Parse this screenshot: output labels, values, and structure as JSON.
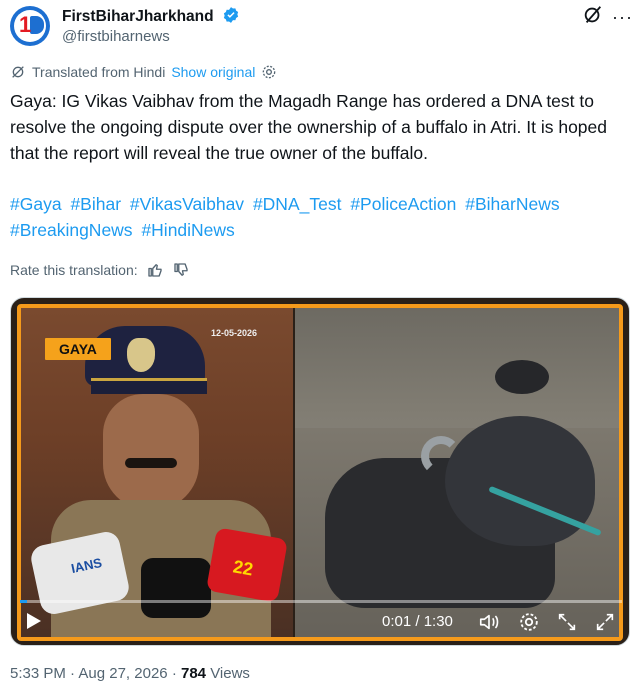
{
  "account": {
    "display_name": "FirstBiharJharkhand",
    "handle": "@firstbiharnews"
  },
  "translation": {
    "label": "Translated from Hindi",
    "show_original": "Show original",
    "rate_label": "Rate this translation:"
  },
  "tweet": {
    "text": "Gaya: IG Vikas Vaibhav from the Magadh Range has ordered a DNA test to resolve the ongoing dispute over the ownership of a buffalo in Atri. It is hoped that the report will reveal the true owner of the buffalo.",
    "hashtags": [
      "#Gaya",
      "#Bihar",
      "#VikasVaibhav",
      "#DNA_Test",
      "#PoliceAction",
      "#BiharNews",
      "#BreakingNews",
      "#HindiNews"
    ]
  },
  "media": {
    "overlay_tag": "GAYA",
    "date_stamp": "12-05-2026",
    "mic_labels": [
      "IANS",
      "22"
    ],
    "time": "0:01 / 1:30",
    "progress": 0.011
  },
  "meta": {
    "time": "5:33 PM",
    "separator": "·",
    "date": "Aug 27, 2026",
    "views_count": "784",
    "views_label": "Views"
  },
  "colors": {
    "link": "#1d9bf0",
    "secondary_text": "#536471",
    "accent_orange": "#f59a1b"
  },
  "icons": [
    "verified-badge-icon",
    "grok-icon",
    "more-icon",
    "translate-icon",
    "settings-icon",
    "thumbs-up-icon",
    "thumbs-down-icon",
    "play-icon",
    "volume-icon",
    "gear-icon",
    "fullscreen-shrink-icon",
    "expand-icon"
  ]
}
